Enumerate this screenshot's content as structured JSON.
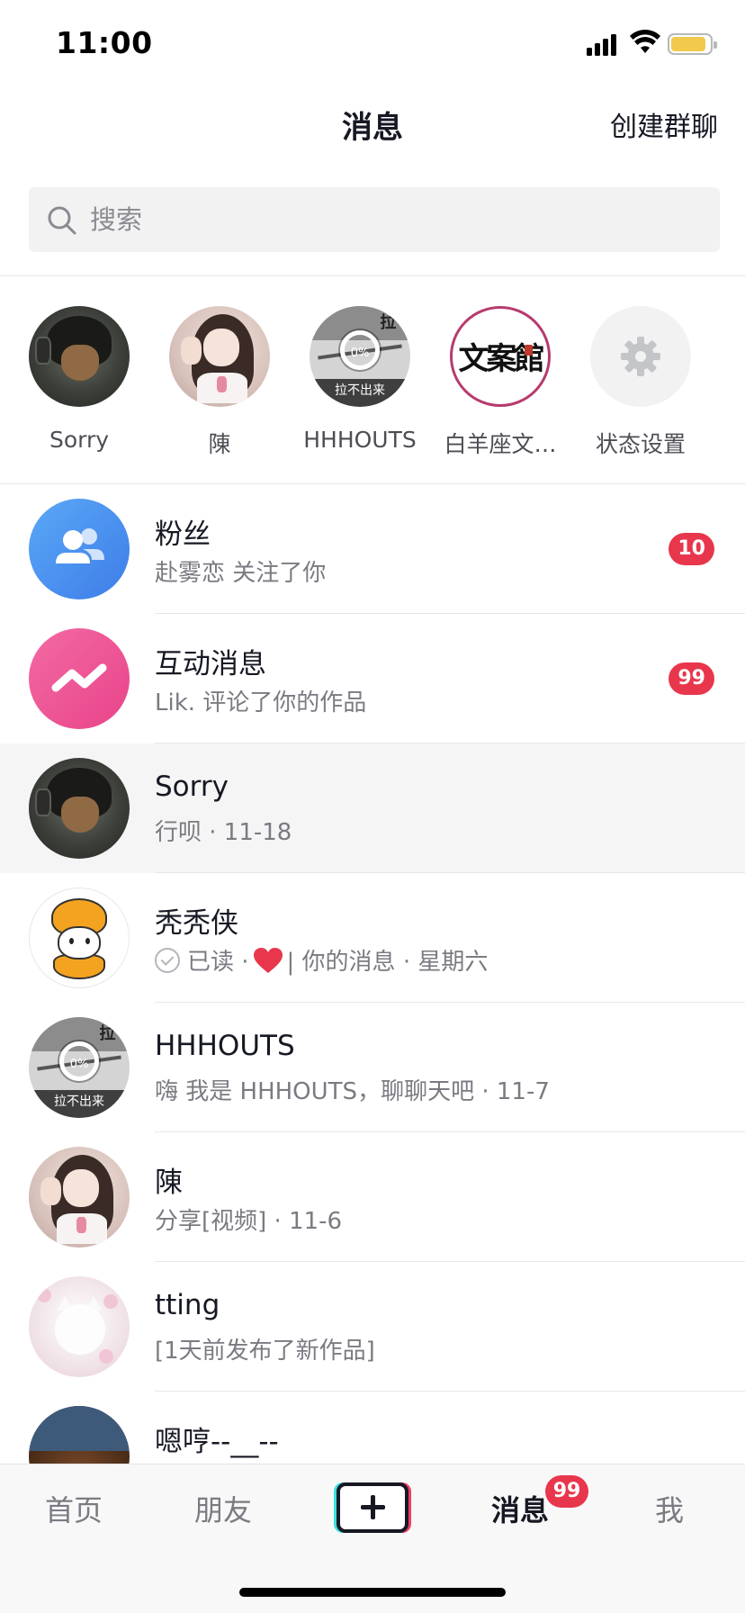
{
  "status_bar": {
    "time": "11:00"
  },
  "header": {
    "title": "消息",
    "create_group": "创建群聊"
  },
  "search": {
    "placeholder": "搜索",
    "value": ""
  },
  "stories": [
    {
      "name": "Sorry"
    },
    {
      "name": "陳"
    },
    {
      "name": "HHHOUTS",
      "progress_label": "0%",
      "caption": "拉不出来",
      "corner": "拉"
    },
    {
      "name": "白羊座文…",
      "logo_text": "文案館"
    },
    {
      "name": "状态设置"
    }
  ],
  "messages": [
    {
      "title": "粉丝",
      "subtitle": "赴雾恋 关注了你",
      "badge": "10"
    },
    {
      "title": "互动消息",
      "subtitle": "Lik. 评论了你的作品",
      "badge": "99"
    },
    {
      "title": "Sorry",
      "subtitle": "行呗 · 11-18"
    },
    {
      "title": "秃秃侠",
      "read_label": "已读 ·",
      "subtitle_after": "| 你的消息 · 星期六"
    },
    {
      "title": "HHHOUTS",
      "subtitle": "嗨 我是 HHHOUTS，聊聊天吧 · 11-7",
      "progress_label": "0%",
      "caption": "拉不出来",
      "corner": "拉"
    },
    {
      "title": "陳",
      "subtitle": "分享[视频] · 11-6"
    },
    {
      "title": "tting",
      "subtitle": "[1天前发布了新作品]"
    },
    {
      "title": "嗯哼--__--"
    }
  ],
  "bottom_nav": {
    "home": "首页",
    "friends": "朋友",
    "messages": "消息",
    "messages_badge": "99",
    "me": "我"
  },
  "colors": {
    "badge": "#e8364c",
    "fans_avatar": "#4a90ee",
    "interact_avatar": "#ee5a98",
    "heart": "#e8364c"
  },
  "icons": {
    "search": "search-icon",
    "settings": "gear-icon",
    "fans": "people-icon",
    "interact": "zigzag-icon",
    "read": "check-circle-icon",
    "heart": "heart-icon",
    "publish": "plus-icon"
  }
}
